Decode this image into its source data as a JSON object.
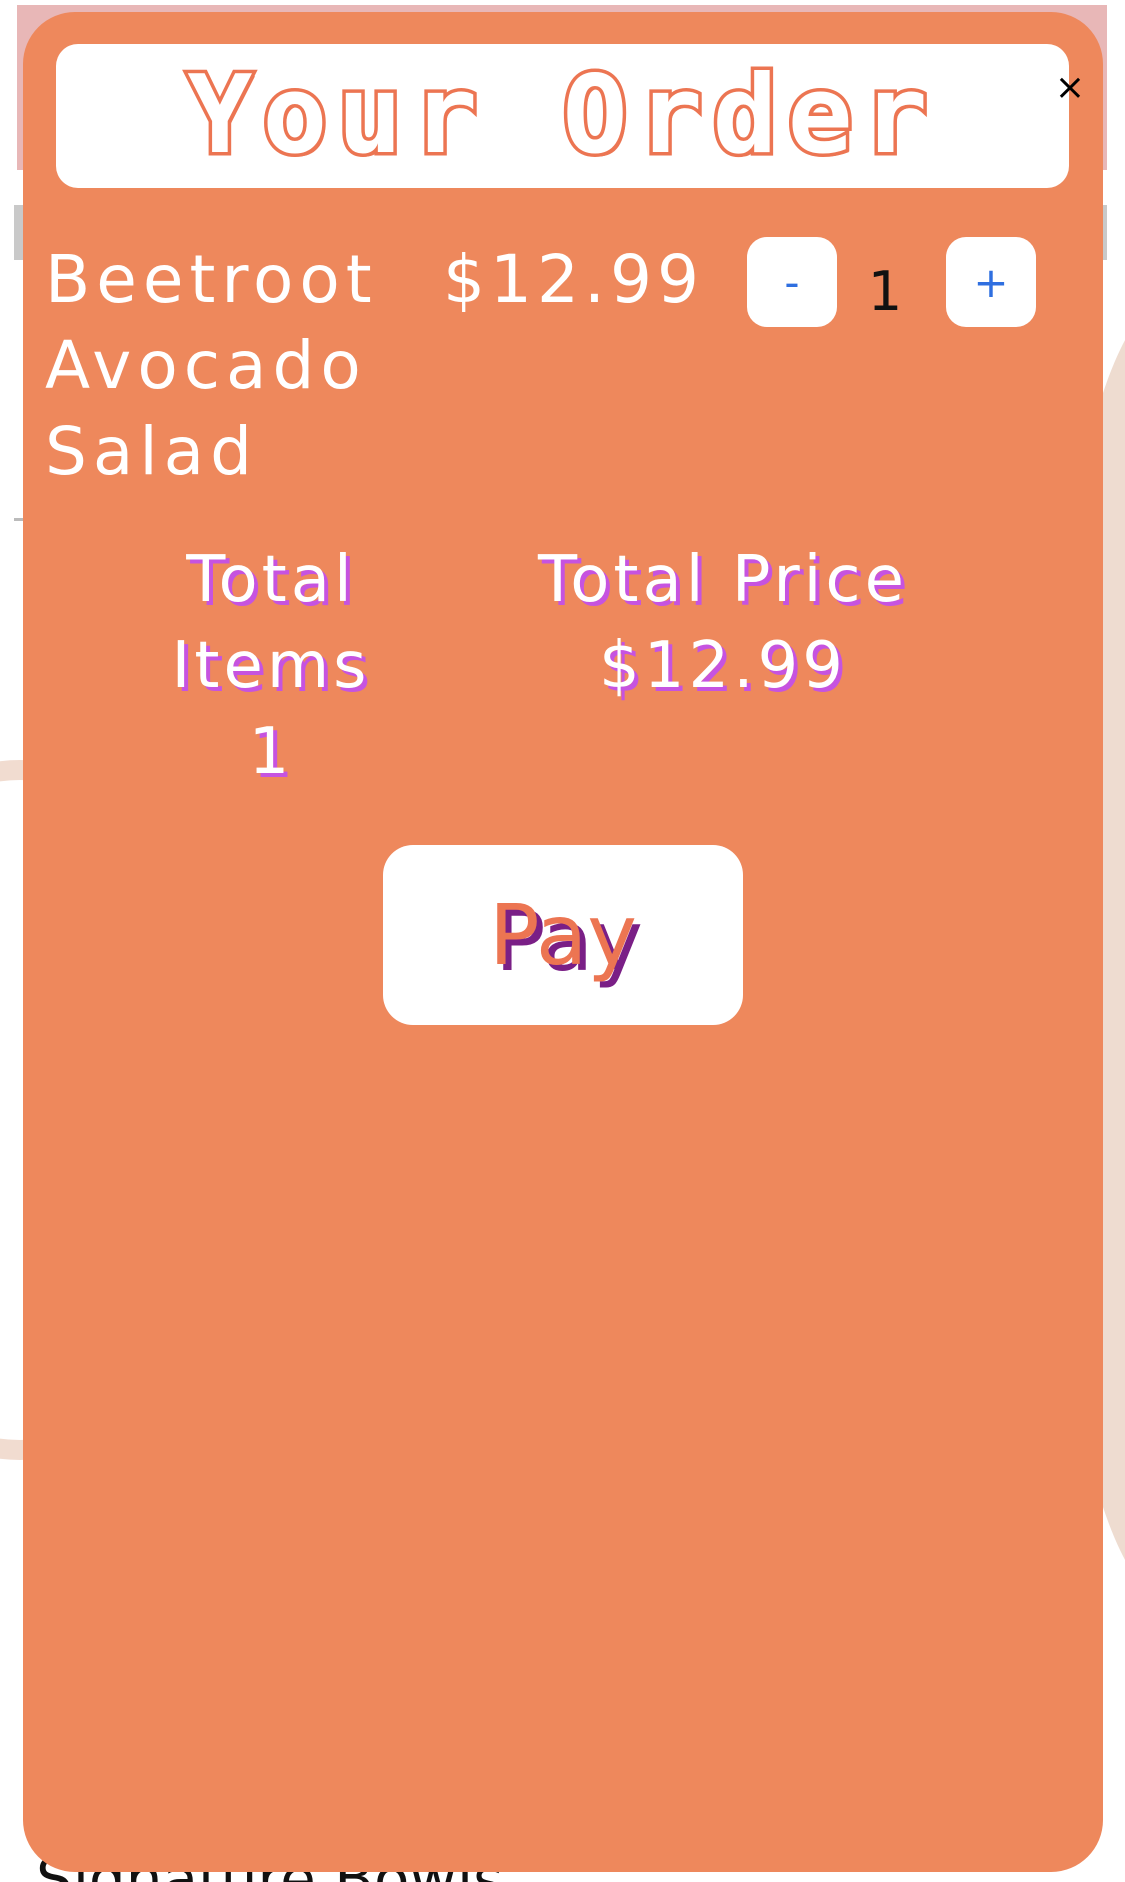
{
  "background": {
    "footer_text": "Signature Bowls"
  },
  "modal": {
    "title": "Your Order",
    "close_label": "×",
    "item": {
      "name": "Beetroot Avocado Salad",
      "price": "$12.99",
      "minus_label": "-",
      "plus_label": "+",
      "quantity": "1"
    },
    "summary": {
      "total_items_label": "Total Items",
      "total_items_value": "1",
      "total_price_label": "Total Price",
      "total_price_value": "$12.99"
    },
    "pay_label": "Pay"
  },
  "colors": {
    "modal_bg": "#ee885c",
    "title_outline": "#ec7552",
    "summary_shadow": "#c653e0",
    "qty_button_text": "#2f6fe0",
    "pay_shadow": "#7a1f86"
  }
}
